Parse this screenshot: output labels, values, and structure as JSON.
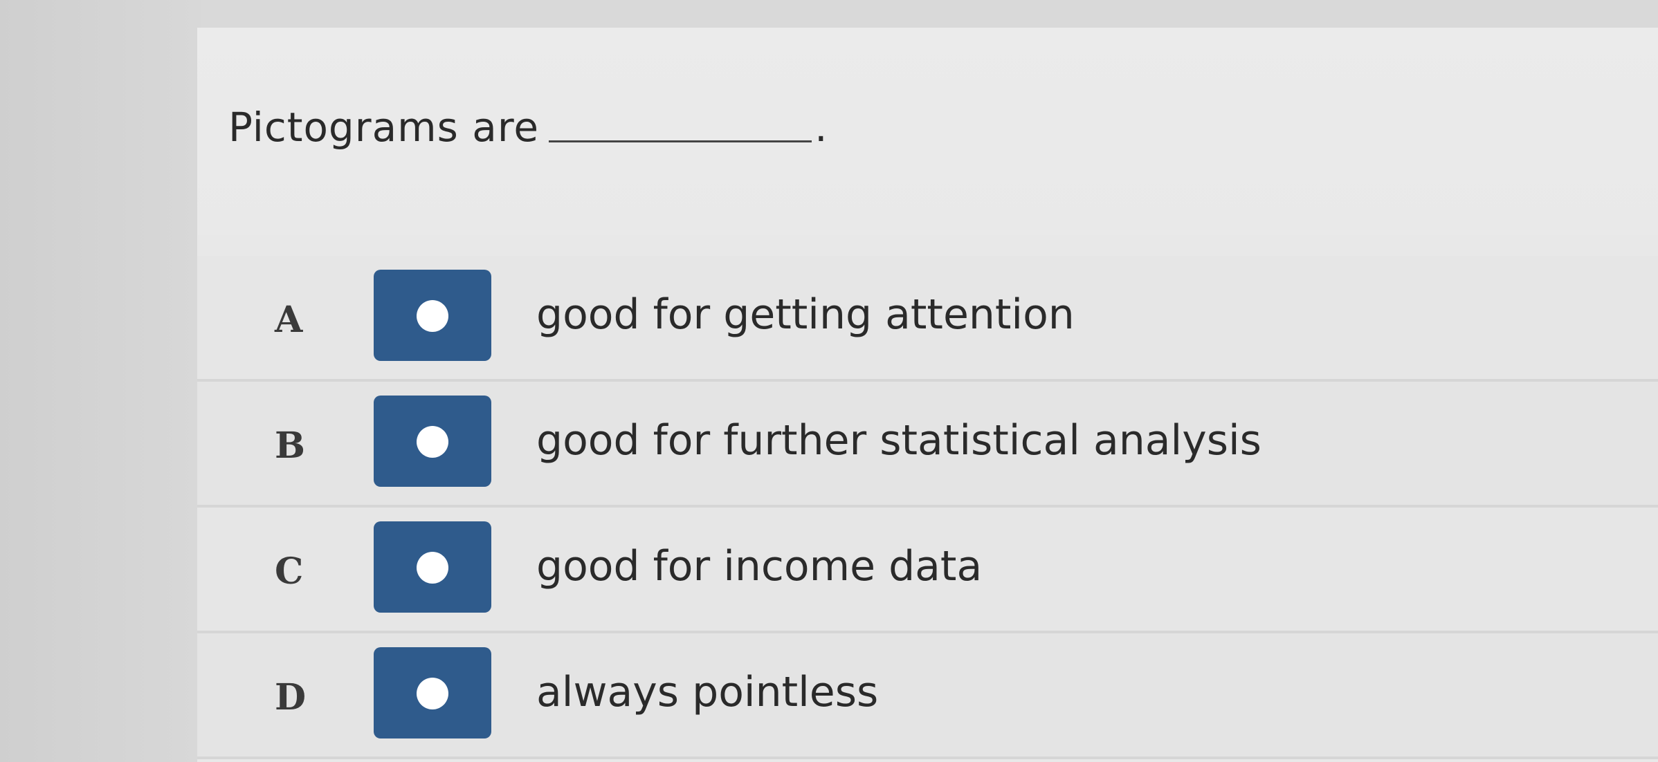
{
  "question": {
    "text": "Pictograms are",
    "period": "."
  },
  "options": [
    {
      "letter": "A",
      "text": "good for getting attention"
    },
    {
      "letter": "B",
      "text": "good for further statistical analysis"
    },
    {
      "letter": "C",
      "text": "good for income data"
    },
    {
      "letter": "D",
      "text": "always pointless"
    }
  ],
  "colors": {
    "radio_fill": "#2f5b8c",
    "radio_dot": "#ffffff"
  }
}
